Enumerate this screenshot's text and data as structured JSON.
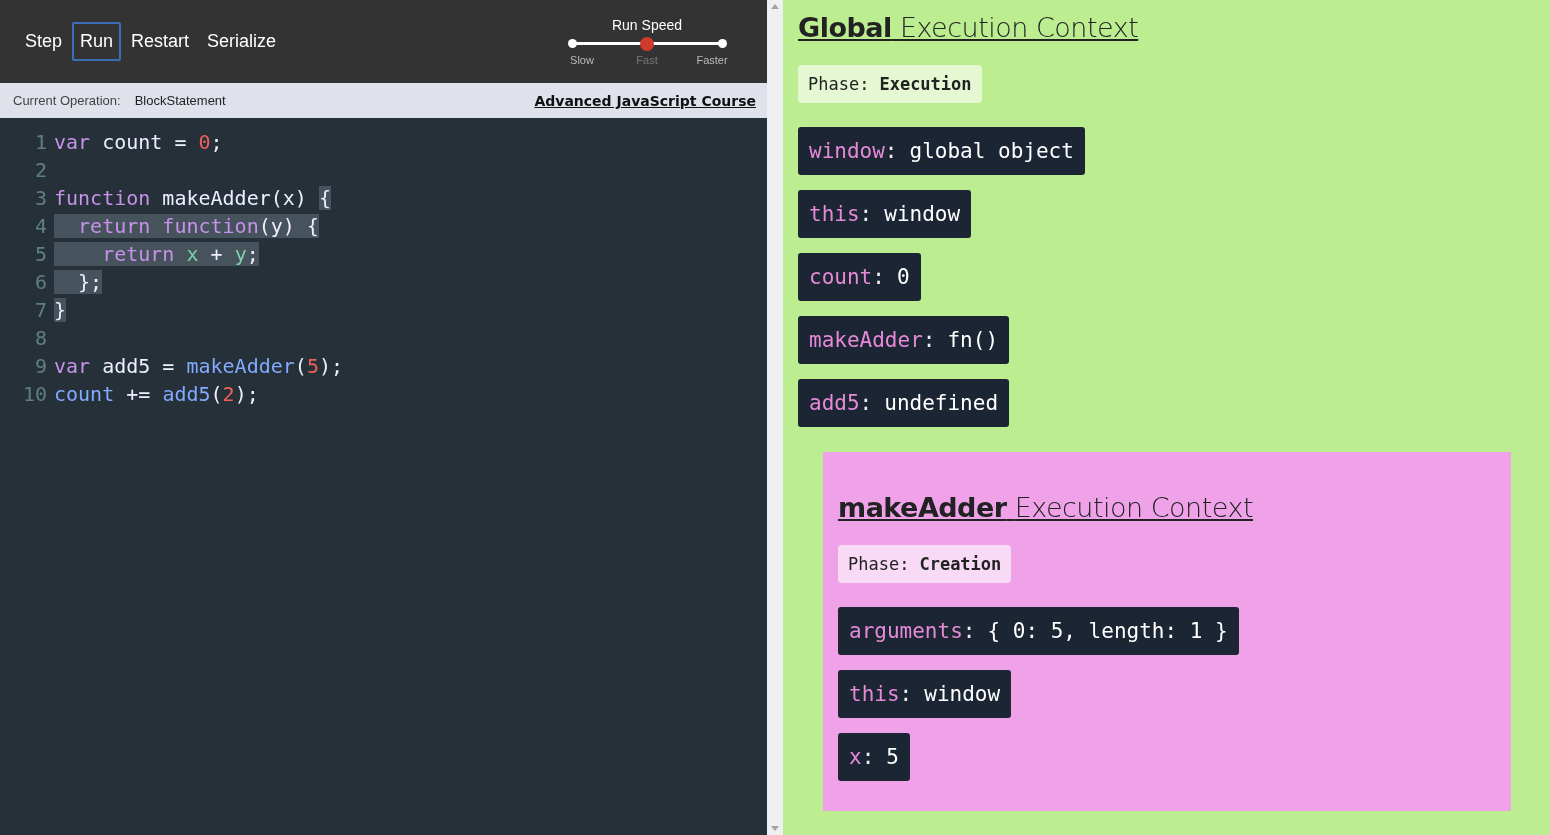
{
  "toolbar": {
    "buttons": [
      {
        "label": "Step",
        "selected": false
      },
      {
        "label": "Run",
        "selected": true
      },
      {
        "label": "Restart",
        "selected": false
      },
      {
        "label": "Serialize",
        "selected": false
      }
    ]
  },
  "speed": {
    "title": "Run Speed",
    "level": 0.5,
    "options": [
      {
        "label": "Slow",
        "selected": false
      },
      {
        "label": "Fast",
        "selected": true
      },
      {
        "label": "Faster",
        "selected": false
      }
    ]
  },
  "status": {
    "label": "Current Operation:",
    "value": "BlockStatement",
    "link": "Advanced JavaScript Course"
  },
  "code": [
    {
      "number": "1",
      "tokens": [
        {
          "text": "var",
          "kind": "keyword",
          "highlighted": false
        },
        {
          "text": " count = ",
          "kind": "plain",
          "highlighted": false
        },
        {
          "text": "0",
          "kind": "number",
          "highlighted": false
        },
        {
          "text": ";",
          "kind": "plain",
          "highlighted": false
        }
      ]
    },
    {
      "number": "2"
    },
    {
      "number": "3",
      "tokens": [
        {
          "text": "function",
          "kind": "keyword",
          "highlighted": false
        },
        {
          "text": " makeAdder(x) ",
          "kind": "plain",
          "highlighted": false
        },
        {
          "text": "{",
          "kind": "plain",
          "highlighted": true
        }
      ]
    },
    {
      "number": "4",
      "tokens": [
        {
          "text": "  return",
          "kind": "keyword",
          "highlighted": true
        },
        {
          "text": " function",
          "kind": "keyword",
          "highlighted": true
        },
        {
          "text": "(y) {",
          "kind": "plain",
          "highlighted": true
        }
      ]
    },
    {
      "number": "5",
      "tokens": [
        {
          "text": "    return",
          "kind": "keyword",
          "highlighted": true
        },
        {
          "text": " x",
          "kind": "param",
          "highlighted": true
        },
        {
          "text": " + ",
          "kind": "plain",
          "highlighted": true
        },
        {
          "text": "y",
          "kind": "param",
          "highlighted": true
        },
        {
          "text": ";",
          "kind": "plain",
          "highlighted": true
        }
      ]
    },
    {
      "number": "6",
      "tokens": [
        {
          "text": "  };",
          "kind": "plain",
          "highlighted": true
        }
      ]
    },
    {
      "number": "7",
      "tokens": [
        {
          "text": "}",
          "kind": "plain",
          "highlighted": true
        }
      ]
    },
    {
      "number": "8"
    },
    {
      "number": "9",
      "tokens": [
        {
          "text": "var",
          "kind": "keyword",
          "highlighted": false
        },
        {
          "text": " add5 = ",
          "kind": "plain",
          "highlighted": false
        },
        {
          "text": "makeAdder",
          "kind": "call",
          "highlighted": false
        },
        {
          "text": "(",
          "kind": "plain",
          "highlighted": false
        },
        {
          "text": "5",
          "kind": "number",
          "highlighted": false
        },
        {
          "text": ");",
          "kind": "plain",
          "highlighted": false
        }
      ]
    },
    {
      "number": "10",
      "tokens": [
        {
          "text": "count",
          "kind": "call",
          "highlighted": false
        },
        {
          "text": " += ",
          "kind": "plain",
          "highlighted": false
        },
        {
          "text": "add5",
          "kind": "call",
          "highlighted": false
        },
        {
          "text": "(",
          "kind": "plain",
          "highlighted": false
        },
        {
          "text": "2",
          "kind": "number",
          "highlighted": false
        },
        {
          "text": ");",
          "kind": "plain",
          "highlighted": false
        }
      ]
    }
  ],
  "context": {
    "name": "Global",
    "title": "Execution Context",
    "color": "#bded91",
    "phase_label": "Phase:",
    "phase": "Execution",
    "variables": [
      {
        "name": "window",
        "separator": ":",
        "value": "global object"
      },
      {
        "name": "this",
        "separator": ":",
        "value": "window"
      },
      {
        "name": "count",
        "separator": ":",
        "value": "0"
      },
      {
        "name": "makeAdder",
        "separator": ":",
        "value": "fn()"
      },
      {
        "name": "add5",
        "separator": ":",
        "value": "undefined"
      }
    ],
    "children": [
      {
        "name": "makeAdder",
        "title": "Execution Context",
        "color": "#f0a2e9",
        "phase_label": "Phase:",
        "phase": "Creation",
        "variables": [
          {
            "name": "arguments",
            "separator": ":",
            "value": "{ 0: 5, length: 1 }"
          },
          {
            "name": "this",
            "separator": ":",
            "value": "window"
          },
          {
            "name": "x",
            "separator": ":",
            "value": "5"
          }
        ]
      }
    ]
  }
}
